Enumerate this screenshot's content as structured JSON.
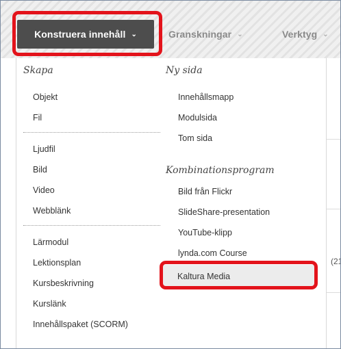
{
  "toolbar": {
    "build_content_label": "Konstruera innehåll",
    "reviews_label": "Granskningar",
    "tools_label": "Verktyg"
  },
  "menu": {
    "left": {
      "heading": "Skapa",
      "group1": [
        "Objekt",
        "Fil"
      ],
      "group2": [
        "Ljudfil",
        "Bild",
        "Video",
        "Webblänk"
      ],
      "group3": [
        "Lärmodul",
        "Lektionsplan",
        "Kursbeskrivning",
        "Kurslänk",
        "Innehållspaket (SCORM)"
      ]
    },
    "right": {
      "heading_new_page": "Ny sida",
      "new_page_items": [
        "Innehållsmapp",
        "Modulsida",
        "Tom sida"
      ],
      "heading_mashups": "Kombinationsprogram",
      "mashup_items": [
        "Bild från Flickr",
        "SlideShare-presentation",
        "YouTube-klipp",
        "lynda.com Course",
        "Kaltura Media"
      ]
    }
  },
  "background": {
    "partial_text": "(21"
  },
  "colors": {
    "highlight": "#e3131b",
    "active_button": "#4d4d4d"
  }
}
